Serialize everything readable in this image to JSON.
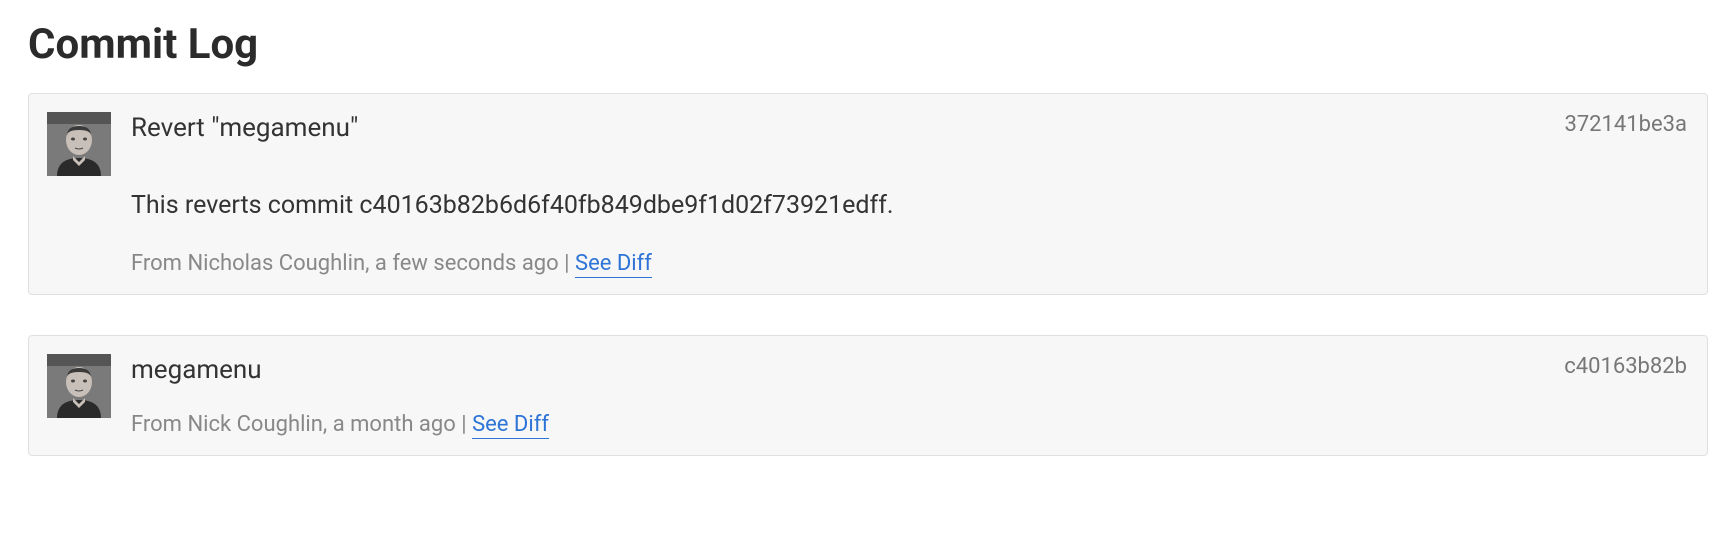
{
  "page": {
    "title": "Commit Log"
  },
  "commits": [
    {
      "title": "Revert \"megamenu\"",
      "hash": "372141be3a",
      "message": "This reverts commit c40163b82b6d6f40fb849dbe9f1d02f73921edff.",
      "author": "Nicholas Coughlin",
      "time_ago": "a few seconds ago",
      "diff_link_label": "See Diff"
    },
    {
      "title": "megamenu",
      "hash": "c40163b82b",
      "message": "",
      "author": "Nick Coughlin",
      "time_ago": "a month ago",
      "diff_link_label": "See Diff"
    }
  ],
  "labels": {
    "from_prefix": "From",
    "separator": " | "
  }
}
